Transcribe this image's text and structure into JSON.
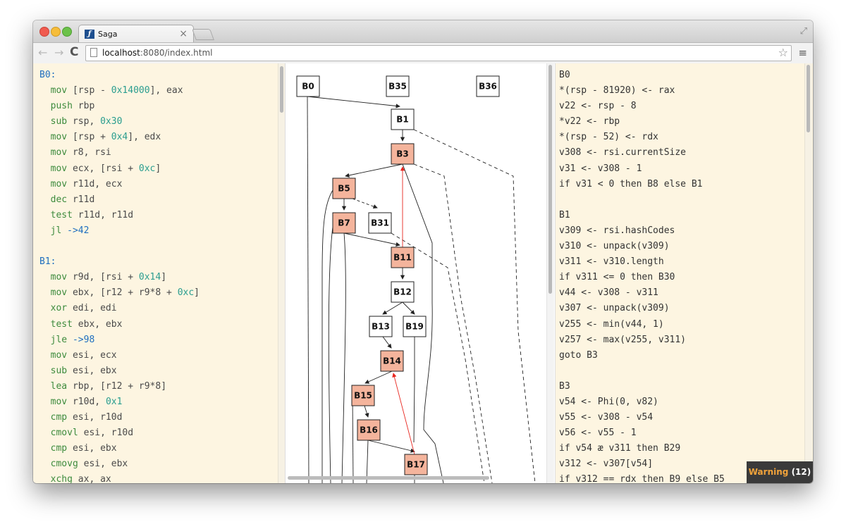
{
  "browser": {
    "tab_title": "Saga",
    "favicon_text": "ƒ",
    "tab_close": "×",
    "url_host": "localhost",
    "url_rest": ":8080/index.html",
    "back": "←",
    "forward": "→",
    "reload": "C",
    "star": "☆",
    "menu": "≡",
    "fullscreen": "⤢"
  },
  "asm": {
    "lines": [
      [
        {
          "t": "label",
          "v": "B0:"
        }
      ],
      [
        {
          "t": "i",
          "v": "  "
        },
        {
          "t": "mnem",
          "v": "mov"
        },
        {
          "t": "p",
          "v": " [rsp - "
        },
        {
          "t": "num",
          "v": "0x14000"
        },
        {
          "t": "p",
          "v": "], eax"
        }
      ],
      [
        {
          "t": "i",
          "v": "  "
        },
        {
          "t": "mnem",
          "v": "push"
        },
        {
          "t": "p",
          "v": " rbp"
        }
      ],
      [
        {
          "t": "i",
          "v": "  "
        },
        {
          "t": "mnem",
          "v": "sub"
        },
        {
          "t": "p",
          "v": " rsp, "
        },
        {
          "t": "num",
          "v": "0x30"
        }
      ],
      [
        {
          "t": "i",
          "v": "  "
        },
        {
          "t": "mnem",
          "v": "mov"
        },
        {
          "t": "p",
          "v": " [rsp + "
        },
        {
          "t": "num",
          "v": "0x4"
        },
        {
          "t": "p",
          "v": "], edx"
        }
      ],
      [
        {
          "t": "i",
          "v": "  "
        },
        {
          "t": "mnem",
          "v": "mov"
        },
        {
          "t": "p",
          "v": " r8, rsi"
        }
      ],
      [
        {
          "t": "i",
          "v": "  "
        },
        {
          "t": "mnem",
          "v": "mov"
        },
        {
          "t": "p",
          "v": " ecx, [rsi + "
        },
        {
          "t": "num",
          "v": "0xc"
        },
        {
          "t": "p",
          "v": "]"
        }
      ],
      [
        {
          "t": "i",
          "v": "  "
        },
        {
          "t": "mnem",
          "v": "mov"
        },
        {
          "t": "p",
          "v": " r11d, ecx"
        }
      ],
      [
        {
          "t": "i",
          "v": "  "
        },
        {
          "t": "mnem",
          "v": "dec"
        },
        {
          "t": "p",
          "v": " r11d"
        }
      ],
      [
        {
          "t": "i",
          "v": "  "
        },
        {
          "t": "mnem",
          "v": "test"
        },
        {
          "t": "p",
          "v": " r11d, r11d"
        }
      ],
      [
        {
          "t": "i",
          "v": "  "
        },
        {
          "t": "mnem",
          "v": "jl"
        },
        {
          "t": "p",
          "v": " "
        },
        {
          "t": "jmp",
          "v": "->42"
        }
      ],
      [],
      [
        {
          "t": "label",
          "v": "B1:"
        }
      ],
      [
        {
          "t": "i",
          "v": "  "
        },
        {
          "t": "mnem",
          "v": "mov"
        },
        {
          "t": "p",
          "v": " r9d, [rsi + "
        },
        {
          "t": "num",
          "v": "0x14"
        },
        {
          "t": "p",
          "v": "]"
        }
      ],
      [
        {
          "t": "i",
          "v": "  "
        },
        {
          "t": "mnem",
          "v": "mov"
        },
        {
          "t": "p",
          "v": " ebx, [r12 + r9*8 + "
        },
        {
          "t": "num",
          "v": "0xc"
        },
        {
          "t": "p",
          "v": "]"
        }
      ],
      [
        {
          "t": "i",
          "v": "  "
        },
        {
          "t": "mnem",
          "v": "xor"
        },
        {
          "t": "p",
          "v": " edi, edi"
        }
      ],
      [
        {
          "t": "i",
          "v": "  "
        },
        {
          "t": "mnem",
          "v": "test"
        },
        {
          "t": "p",
          "v": " ebx, ebx"
        }
      ],
      [
        {
          "t": "i",
          "v": "  "
        },
        {
          "t": "mnem",
          "v": "jle"
        },
        {
          "t": "p",
          "v": " "
        },
        {
          "t": "jmp",
          "v": "->98"
        }
      ],
      [
        {
          "t": "i",
          "v": "  "
        },
        {
          "t": "mnem",
          "v": "mov"
        },
        {
          "t": "p",
          "v": " esi, ecx"
        }
      ],
      [
        {
          "t": "i",
          "v": "  "
        },
        {
          "t": "mnem",
          "v": "sub"
        },
        {
          "t": "p",
          "v": " esi, ebx"
        }
      ],
      [
        {
          "t": "i",
          "v": "  "
        },
        {
          "t": "mnem",
          "v": "lea"
        },
        {
          "t": "p",
          "v": " rbp, [r12 + r9*8]"
        }
      ],
      [
        {
          "t": "i",
          "v": "  "
        },
        {
          "t": "mnem",
          "v": "mov"
        },
        {
          "t": "p",
          "v": " r10d, "
        },
        {
          "t": "num",
          "v": "0x1"
        }
      ],
      [
        {
          "t": "i",
          "v": "  "
        },
        {
          "t": "mnem",
          "v": "cmp"
        },
        {
          "t": "p",
          "v": " esi, r10d"
        }
      ],
      [
        {
          "t": "i",
          "v": "  "
        },
        {
          "t": "mnem",
          "v": "cmovl"
        },
        {
          "t": "p",
          "v": " esi, r10d"
        }
      ],
      [
        {
          "t": "i",
          "v": "  "
        },
        {
          "t": "mnem",
          "v": "cmp"
        },
        {
          "t": "p",
          "v": " esi, ebx"
        }
      ],
      [
        {
          "t": "i",
          "v": "  "
        },
        {
          "t": "mnem",
          "v": "cmovg"
        },
        {
          "t": "p",
          "v": " esi, ebx"
        }
      ],
      [
        {
          "t": "i",
          "v": "  "
        },
        {
          "t": "mnem",
          "v": "xchg"
        },
        {
          "t": "p",
          "v": " ax, ax"
        }
      ]
    ]
  },
  "cfg": {
    "nodes": [
      {
        "label": "B0",
        "highlight": false
      },
      {
        "label": "B35",
        "highlight": false
      },
      {
        "label": "B36",
        "highlight": false
      },
      {
        "label": "B1",
        "highlight": false
      },
      {
        "label": "B3",
        "highlight": true
      },
      {
        "label": "B5",
        "highlight": true
      },
      {
        "label": "B7",
        "highlight": true
      },
      {
        "label": "B31",
        "highlight": false
      },
      {
        "label": "B11",
        "highlight": true
      },
      {
        "label": "B12",
        "highlight": false
      },
      {
        "label": "B13",
        "highlight": false
      },
      {
        "label": "B19",
        "highlight": false
      },
      {
        "label": "B14",
        "highlight": true
      },
      {
        "label": "B15",
        "highlight": true
      },
      {
        "label": "B16",
        "highlight": true
      },
      {
        "label": "B17",
        "highlight": true
      }
    ],
    "highlight_color": "#f4b49c",
    "normal_color": "#ffffff",
    "backedge_color": "#e8261f"
  },
  "ir": {
    "lines": [
      "B0",
      "*(rsp - 81920) <- rax",
      "v22 <- rsp - 8",
      "*v22 <- rbp",
      "*(rsp - 52) <- rdx",
      "v308 <- rsi.currentSize",
      "v31 <- v308 - 1",
      "if v31 < 0 then B8 else B1",
      "",
      "B1",
      "v309 <- rsi.hashCodes",
      "v310 <- unpack(v309)",
      "v311 <- v310.length",
      "if v311 <= 0 then B30",
      "v44 <- v308 - v311",
      "v307 <- unpack(v309)",
      "v255 <- min(v44, 1)",
      "v257 <- max(v255, v311)",
      "goto B3",
      "",
      "B3",
      "v54 <- Phi(0, v82)",
      "v55 <- v308 - v54",
      "v56 <- v55 - 1",
      "if v54 æ v311 then B29",
      "v312 <- v307[v54]",
      "if v312 == rdx then B9 else B5"
    ]
  },
  "warning": {
    "label": "Warning",
    "count": "(12)",
    "color": "#f2a33a"
  }
}
